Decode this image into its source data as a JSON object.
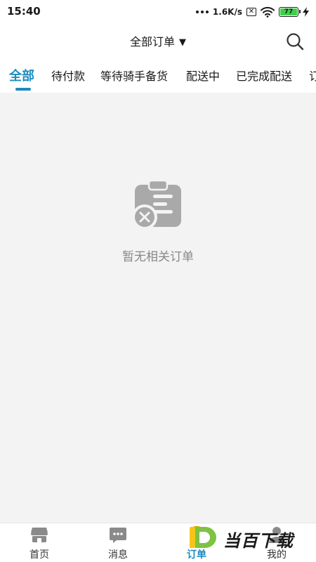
{
  "status_bar": {
    "time": "15:40",
    "speed": "1.6K/s",
    "sim_symbol": "✕",
    "battery": "77"
  },
  "header": {
    "title": "全部订单",
    "caret": "▼",
    "search_icon": "search-icon"
  },
  "tabs": [
    {
      "label": "全部",
      "active": true
    },
    {
      "label": "待付款",
      "active": false
    },
    {
      "label": "等待骑手备货",
      "active": false
    },
    {
      "label": "配送中",
      "active": false
    },
    {
      "label": "已完成配送",
      "active": false
    },
    {
      "label": "订",
      "active": false
    }
  ],
  "empty_state": {
    "icon": "clipboard-cancel-icon",
    "text": "暂无相关订单"
  },
  "bottom_nav": [
    {
      "label": "首页",
      "icon": "store-icon",
      "active": false
    },
    {
      "label": "消息",
      "icon": "chat-icon",
      "active": false
    },
    {
      "label": "订单",
      "icon": "orders-icon",
      "active": true
    },
    {
      "label": "我的",
      "icon": "user-icon",
      "active": false
    }
  ],
  "watermark": {
    "text": "当百下载"
  },
  "colors": {
    "accent": "#1a8bbf",
    "content_bg": "#f3f3f3",
    "empty_text": "#888888",
    "battery": "#3fcf4a",
    "watermark_green": "#7dc242",
    "watermark_yellow": "#f5c518"
  }
}
